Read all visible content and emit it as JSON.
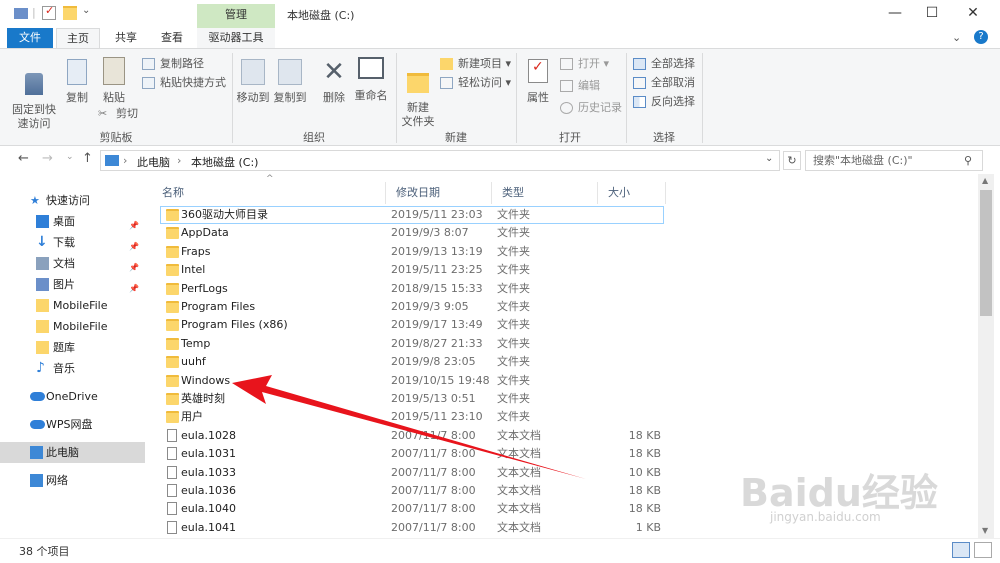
{
  "window": {
    "context_tab": "管理",
    "title": "本地磁盘 (C:)",
    "min": "—",
    "max": "☐",
    "close": "✕"
  },
  "tabs": [
    "文件",
    "主页",
    "共享",
    "查看",
    "驱动器工具"
  ],
  "ribbon": {
    "clipboard": {
      "pin": "固定到快\n速访问",
      "copy": "复制",
      "paste": "粘贴",
      "copy_path": "复制路径",
      "paste_shortcut": "粘贴快捷方式",
      "cut": "剪切",
      "group": "剪贴板"
    },
    "organize": {
      "move_to": "移动到",
      "copy_to": "复制到",
      "delete": "删除",
      "rename": "重命名",
      "group": "组织"
    },
    "new": {
      "new_folder": "新建\n文件夹",
      "new_item": "新建项目",
      "easy_access": "轻松访问",
      "group": "新建"
    },
    "open": {
      "properties": "属性",
      "open": "打开",
      "edit": "编辑",
      "history": "历史记录",
      "group": "打开"
    },
    "select": {
      "select_all": "全部选择",
      "select_none": "全部取消",
      "invert": "反向选择",
      "group": "选择"
    }
  },
  "address": {
    "crumb1": "此电脑",
    "crumb2": "本地磁盘 (C:)",
    "search_placeholder": "搜索\"本地磁盘 (C:)\""
  },
  "sidebar": [
    {
      "label": "快速访问",
      "icon": "star-icon",
      "pin": false
    },
    {
      "label": "桌面",
      "icon": "desktop-icon",
      "pin": true
    },
    {
      "label": "下载",
      "icon": "download-icon",
      "pin": true
    },
    {
      "label": "文档",
      "icon": "document-icon",
      "pin": true
    },
    {
      "label": "图片",
      "icon": "picture-icon",
      "pin": true
    },
    {
      "label": "MobileFile",
      "icon": "folder-icon",
      "pin": false
    },
    {
      "label": "MobileFile",
      "icon": "folder-icon",
      "pin": false
    },
    {
      "label": "题库",
      "icon": "folder-icon",
      "pin": false
    },
    {
      "label": "音乐",
      "icon": "music-icon",
      "pin": false
    },
    {
      "label": "OneDrive",
      "icon": "cloud-icon",
      "pin": false
    },
    {
      "label": "WPS网盘",
      "icon": "cloud-icon",
      "pin": false
    },
    {
      "label": "此电脑",
      "icon": "computer-icon",
      "pin": false
    },
    {
      "label": "网络",
      "icon": "network-icon",
      "pin": false
    }
  ],
  "columns": [
    "名称",
    "修改日期",
    "类型",
    "大小"
  ],
  "files": [
    {
      "name": "360驱动大师目录",
      "date": "2019/5/11 23:03",
      "type": "文件夹",
      "size": "",
      "kind": "folder"
    },
    {
      "name": "AppData",
      "date": "2019/9/3 8:07",
      "type": "文件夹",
      "size": "",
      "kind": "folder"
    },
    {
      "name": "Fraps",
      "date": "2019/9/13 13:19",
      "type": "文件夹",
      "size": "",
      "kind": "folder"
    },
    {
      "name": "Intel",
      "date": "2019/5/11 23:25",
      "type": "文件夹",
      "size": "",
      "kind": "folder"
    },
    {
      "name": "PerfLogs",
      "date": "2018/9/15 15:33",
      "type": "文件夹",
      "size": "",
      "kind": "folder"
    },
    {
      "name": "Program Files",
      "date": "2019/9/3 9:05",
      "type": "文件夹",
      "size": "",
      "kind": "folder"
    },
    {
      "name": "Program Files (x86)",
      "date": "2019/9/17 13:49",
      "type": "文件夹",
      "size": "",
      "kind": "folder"
    },
    {
      "name": "Temp",
      "date": "2019/8/27 21:33",
      "type": "文件夹",
      "size": "",
      "kind": "folder"
    },
    {
      "name": "uuhf",
      "date": "2019/9/8 23:05",
      "type": "文件夹",
      "size": "",
      "kind": "folder"
    },
    {
      "name": "Windows",
      "date": "2019/10/15 19:48",
      "type": "文件夹",
      "size": "",
      "kind": "folder"
    },
    {
      "name": "英雄时刻",
      "date": "2019/5/13 0:51",
      "type": "文件夹",
      "size": "",
      "kind": "folder"
    },
    {
      "name": "用户",
      "date": "2019/5/11 23:10",
      "type": "文件夹",
      "size": "",
      "kind": "folder"
    },
    {
      "name": "eula.1028",
      "date": "2007/11/7 8:00",
      "type": "文本文档",
      "size": "18 KB",
      "kind": "doc"
    },
    {
      "name": "eula.1031",
      "date": "2007/11/7 8:00",
      "type": "文本文档",
      "size": "18 KB",
      "kind": "doc"
    },
    {
      "name": "eula.1033",
      "date": "2007/11/7 8:00",
      "type": "文本文档",
      "size": "10 KB",
      "kind": "doc"
    },
    {
      "name": "eula.1036",
      "date": "2007/11/7 8:00",
      "type": "文本文档",
      "size": "18 KB",
      "kind": "doc"
    },
    {
      "name": "eula.1040",
      "date": "2007/11/7 8:00",
      "type": "文本文档",
      "size": "18 KB",
      "kind": "doc"
    },
    {
      "name": "eula.1041",
      "date": "2007/11/7 8:00",
      "type": "文本文档",
      "size": "1 KB",
      "kind": "doc"
    }
  ],
  "status": {
    "count": "38 个项目"
  },
  "watermark": {
    "logo": "Baidu经验",
    "url": "jingyan.baidu.com"
  },
  "colors": {
    "accent": "#1979ca",
    "context_tab": "#cfe8c3",
    "arrow": "#e8141c",
    "folder": "#fcd66b"
  }
}
